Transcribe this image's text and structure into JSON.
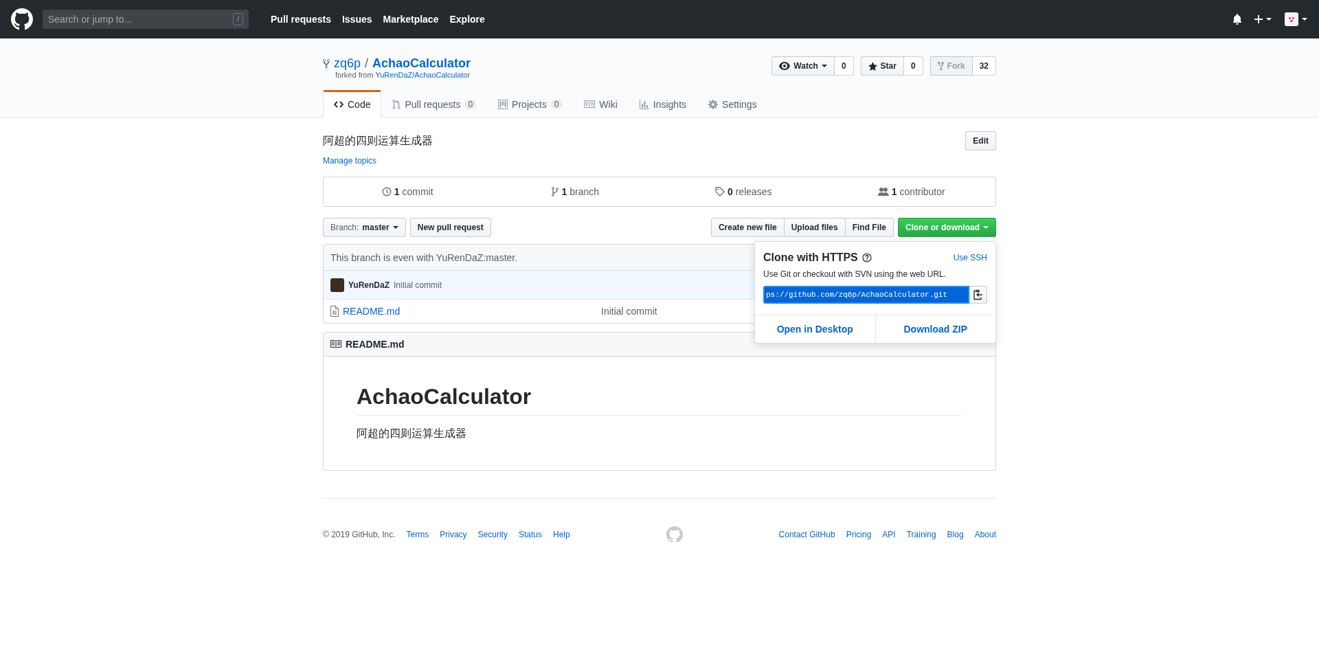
{
  "header": {
    "search_placeholder": "Search or jump to...",
    "search_key": "/",
    "nav": [
      "Pull requests",
      "Issues",
      "Marketplace",
      "Explore"
    ]
  },
  "repo": {
    "owner": "zq6p",
    "separator": "/",
    "name": "AchaoCalculator",
    "forked_from_label": "forked from",
    "forked_from": "YuRenDaZ/AchaoCalculator",
    "actions": [
      {
        "kind": "watch",
        "label": "Watch",
        "count": "0",
        "disabled": false,
        "caret": true
      },
      {
        "kind": "star",
        "label": "Star",
        "count": "0",
        "disabled": false,
        "caret": false
      },
      {
        "kind": "fork",
        "label": "Fork",
        "count": "32",
        "disabled": true,
        "caret": false
      }
    ]
  },
  "tabs": [
    {
      "kind": "code",
      "label": "Code",
      "selected": true
    },
    {
      "kind": "pr",
      "label": "Pull requests",
      "counter": "0",
      "selected": false
    },
    {
      "kind": "projects",
      "label": "Projects",
      "counter": "0",
      "selected": false
    },
    {
      "kind": "wiki",
      "label": "Wiki",
      "selected": false
    },
    {
      "kind": "insights",
      "label": "Insights",
      "selected": false
    },
    {
      "kind": "settings",
      "label": "Settings",
      "selected": false
    }
  ],
  "description": "阿超的四则运算生成器",
  "edit_button": "Edit",
  "manage_topics": "Manage topics",
  "stats": [
    {
      "kind": "commit",
      "count": "1",
      "label": "commit"
    },
    {
      "kind": "branch",
      "count": "1",
      "label": "branch"
    },
    {
      "kind": "tag",
      "count": "0",
      "label": "releases"
    },
    {
      "kind": "people",
      "count": "1",
      "label": "contributor"
    }
  ],
  "branch_select": {
    "prefix": "Branch:",
    "value": "master"
  },
  "new_pull_request": "New pull request",
  "file_buttons": [
    "Create new file",
    "Upload files",
    "Find File"
  ],
  "clone_button": "Clone or download",
  "branch_status": "This branch is even with YuRenDaZ:master.",
  "latest_commit": {
    "author": "YuRenDaZ",
    "message": "Initial commit"
  },
  "files": [
    {
      "name": "README.md",
      "message": "Initial commit"
    }
  ],
  "readme": {
    "title": "README.md",
    "heading": "AchaoCalculator",
    "text": "阿超的四则运算生成器"
  },
  "clone_popup": {
    "title": "Clone with HTTPS",
    "use_ssh": "Use SSH",
    "hint": "Use Git or checkout with SVN using the web URL.",
    "url": "ps://github.com/zq6p/AchaoCalculator.git",
    "actions": [
      "Open in Desktop",
      "Download ZIP"
    ]
  },
  "footer": {
    "copyright": "© 2019 GitHub, Inc.",
    "left_links": [
      "Terms",
      "Privacy",
      "Security",
      "Status",
      "Help"
    ],
    "right_links": [
      "Contact GitHub",
      "Pricing",
      "API",
      "Training",
      "Blog",
      "About"
    ]
  }
}
